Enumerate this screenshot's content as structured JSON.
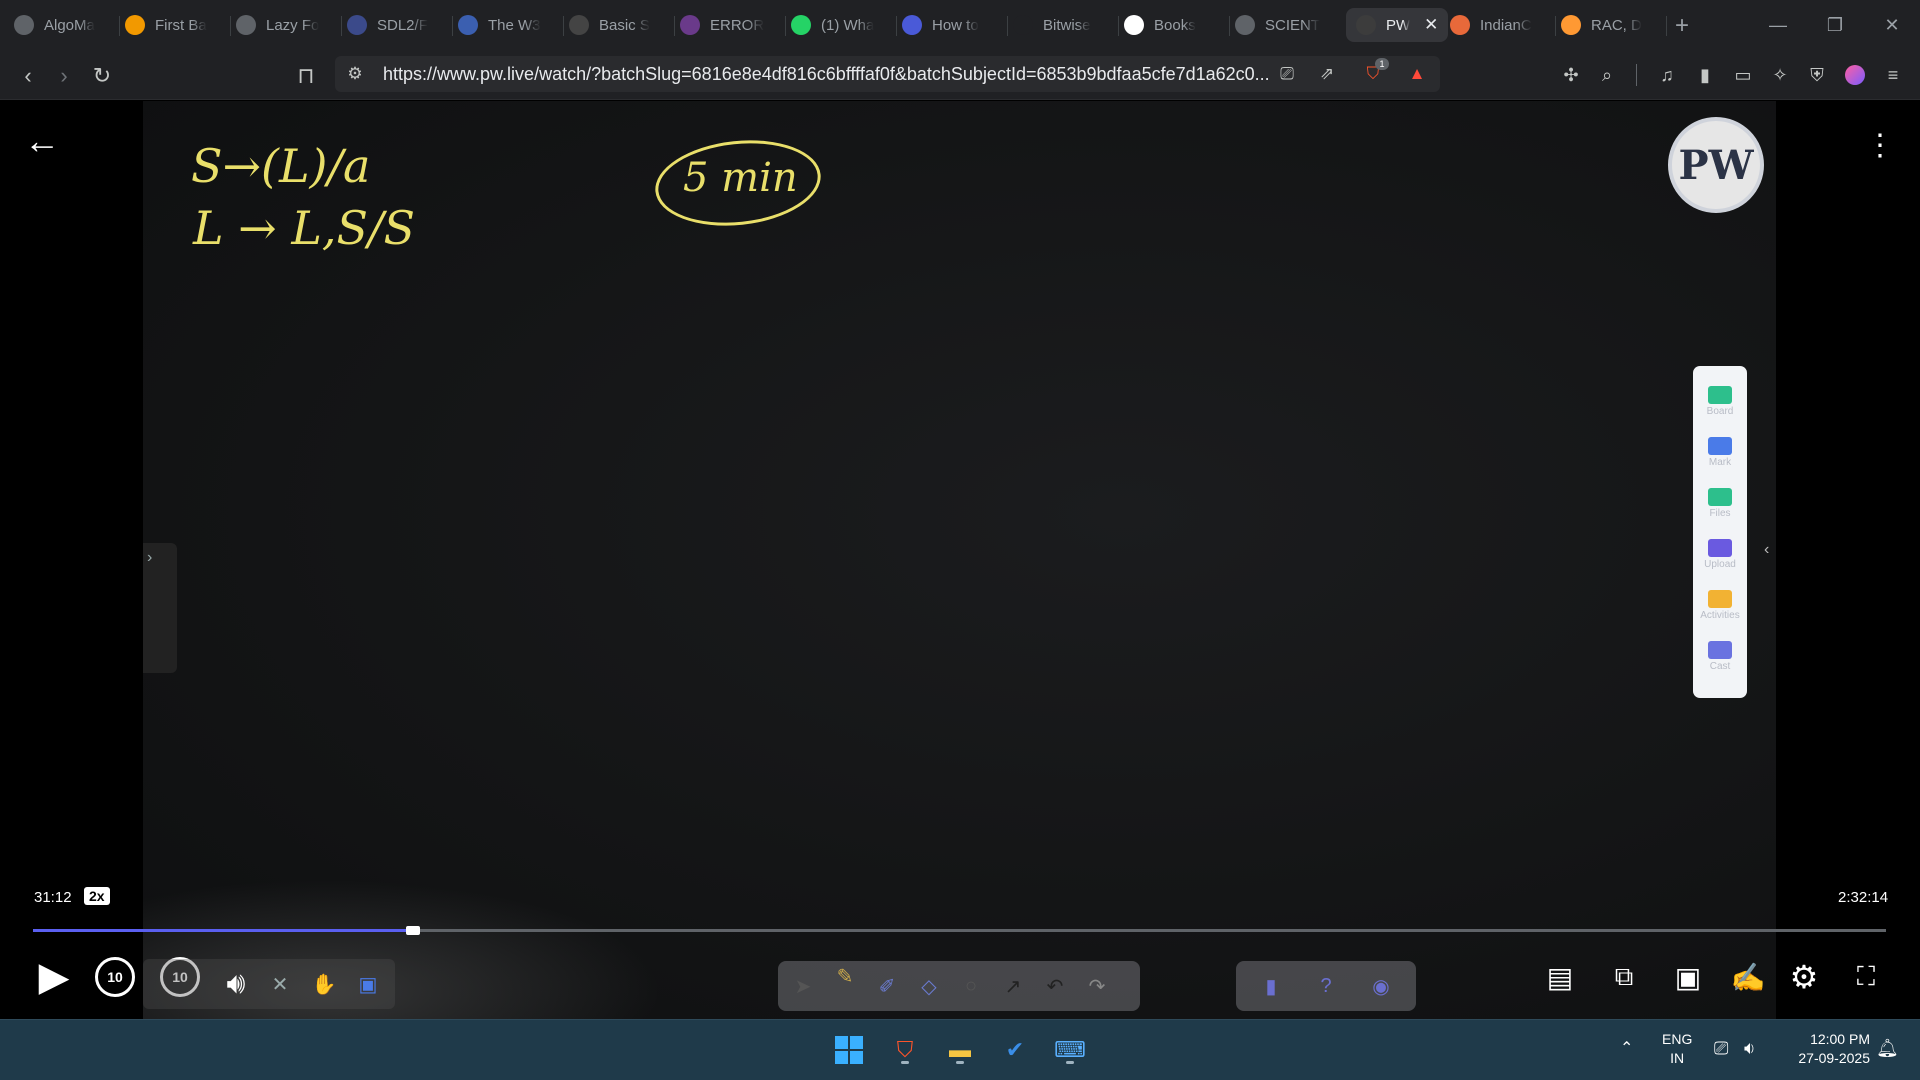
{
  "browser": {
    "tabs": [
      {
        "label": "AlgoMa",
        "icon": "algomaster-icon",
        "color": "#5f6368"
      },
      {
        "label": "First Ba",
        "icon": "code-icon",
        "color": "#f29900"
      },
      {
        "label": "Lazy Fo",
        "icon": "globe-icon",
        "color": "#5f6368"
      },
      {
        "label": "SDL2/F",
        "icon": "sdl-icon",
        "color": "#3b4a8a"
      },
      {
        "label": "The W3",
        "icon": "w3schools-icon",
        "color": "#3b5fb0"
      },
      {
        "label": "Basic S",
        "icon": "page-icon",
        "color": "#444"
      },
      {
        "label": "ERROR",
        "icon": "error-site-icon",
        "color": "#6a3a8a"
      },
      {
        "label": "(1) Wha",
        "icon": "whatsapp-icon",
        "color": "#25d366"
      },
      {
        "label": "How to",
        "icon": "bookmark-icon",
        "color": "#4a5ad8"
      },
      {
        "label": "Bitwise",
        "icon": "orin-icon",
        "color": "#202124"
      },
      {
        "label": "Books",
        "icon": "google-icon",
        "color": "#ffffff"
      },
      {
        "label": "SCIENT",
        "icon": "globe-icon",
        "color": "#5f6368"
      },
      {
        "label": "PW",
        "icon": "pw-icon",
        "color": "#3c3c3c",
        "active": true
      },
      {
        "label": "IndianC",
        "icon": "indian-icon",
        "color": "#e8693a"
      },
      {
        "label": "RAC, D",
        "icon": "india-flag-icon",
        "color": "#ff9933"
      }
    ],
    "url_host": "https://www.pw.live",
    "url_path": "/watch/?batchSlug=6816e8e4df816c6bffffaf0f&batchSubjectId=6853b9bdfaa5cfe7d1a62c0...",
    "brave_badge": "1"
  },
  "player": {
    "board": {
      "line1": "S→(L)/a",
      "line2": "L → L,S/S",
      "timer_note": "5 min"
    },
    "logo_text": "PW",
    "side_panel": [
      {
        "label": "Board",
        "color": "#2dbf8c"
      },
      {
        "label": "Mark",
        "color": "#4a7be8"
      },
      {
        "label": "Files",
        "color": "#2dbf8c"
      },
      {
        "label": "Upload",
        "color": "#6a5ae0"
      },
      {
        "label": "Activities",
        "color": "#f2b233"
      },
      {
        "label": "Cast",
        "color": "#6a72e0"
      }
    ],
    "time_current": "31:12",
    "speed": "2x",
    "time_total": "2:32:14",
    "progress_fraction": 0.205,
    "seek_back_label": "10",
    "seek_forward_label": "10"
  },
  "taskbar": {
    "lang_top": "ENG",
    "lang_bottom": "IN",
    "time": "12:00 PM",
    "date": "27-09-2025"
  }
}
